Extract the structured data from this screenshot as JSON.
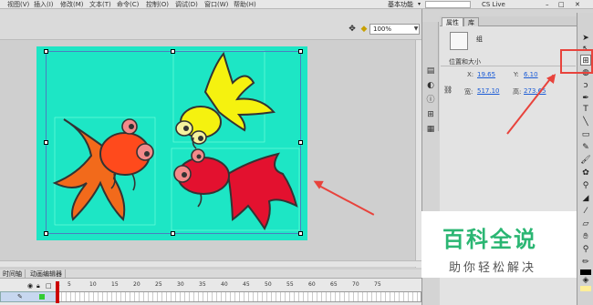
{
  "menubar": {
    "items": [
      "视图(V)",
      "插入(I)",
      "修改(M)",
      "文本(T)",
      "命令(C)",
      "控制(O)",
      "调试(D)",
      "窗口(W)",
      "帮助(H)"
    ],
    "workspace": "基本功能",
    "cs_live": "CS Live"
  },
  "stage": {
    "zoom": "100%",
    "background_color": "#1de6c5"
  },
  "timeline": {
    "tabs": [
      "时间轴",
      "动画编辑器"
    ],
    "ticks": [
      "1",
      "5",
      "10",
      "15",
      "20",
      "25",
      "30",
      "35",
      "40",
      "45",
      "50",
      "55",
      "60",
      "65",
      "70",
      "75"
    ]
  },
  "properties": {
    "tabs": [
      "属性",
      "库"
    ],
    "instance_name": "组",
    "section": "位置和大小",
    "x_label": "X:",
    "x_value": "19.65",
    "y_label": "Y:",
    "y_value": "6.10",
    "w_label": "宽:",
    "w_value": "517.10",
    "h_label": "高:",
    "h_value": "273.65"
  },
  "watermark": {
    "title": "百科全说",
    "subtitle": "助你轻松解决"
  },
  "colors": {
    "accent_red": "#e8433c",
    "stage_teal": "#1de6c5",
    "watermark_green": "#2bb673"
  }
}
